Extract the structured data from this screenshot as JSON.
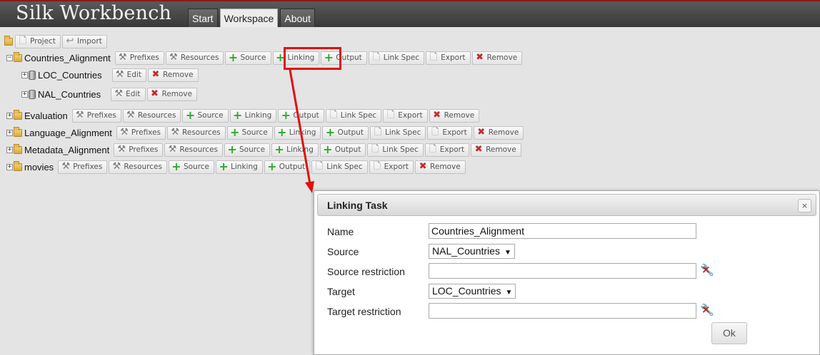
{
  "app": {
    "title": "Silk Workbench"
  },
  "nav": {
    "tabs": [
      {
        "label": "Start"
      },
      {
        "label": "Workspace"
      },
      {
        "label": "About"
      }
    ],
    "active": "Workspace"
  },
  "toolbar": {
    "project_label": "Project",
    "import_label": "Import"
  },
  "projects": [
    {
      "name": "Countries_Alignment",
      "expanded": true,
      "actions": [
        "Prefixes",
        "Resources",
        "Source",
        "Linking",
        "Output",
        "Link Spec",
        "Export",
        "Remove"
      ],
      "sources": [
        {
          "name": "LOC_Countries",
          "actions": [
            "Edit",
            "Remove"
          ]
        },
        {
          "name": "NAL_Countries",
          "actions": [
            "Edit",
            "Remove"
          ]
        }
      ]
    },
    {
      "name": "Evaluation",
      "actions": [
        "Prefixes",
        "Resources",
        "Source",
        "Linking",
        "Output",
        "Link Spec",
        "Export",
        "Remove"
      ]
    },
    {
      "name": "Language_Alignment",
      "actions": [
        "Prefixes",
        "Resources",
        "Source",
        "Linking",
        "Output",
        "Link Spec",
        "Export",
        "Remove"
      ]
    },
    {
      "name": "Metadata_Alignment",
      "actions": [
        "Prefixes",
        "Resources",
        "Source",
        "Linking",
        "Output",
        "Link Spec",
        "Export",
        "Remove"
      ]
    },
    {
      "name": "movies",
      "actions": [
        "Prefixes",
        "Resources",
        "Source",
        "Linking",
        "Output",
        "Link Spec",
        "Export",
        "Remove"
      ]
    }
  ],
  "dialog": {
    "title": "Linking Task",
    "close_label": "×",
    "name_label": "Name",
    "name_value": "Countries_Alignment",
    "source_label": "Source",
    "source_value": "NAL_Countries",
    "source_restriction_label": "Source restriction",
    "source_restriction_value": "",
    "target_label": "Target",
    "target_value": "LOC_Countries",
    "target_restriction_label": "Target restriction",
    "target_restriction_value": "",
    "ok_label": "Ok"
  },
  "colors": {
    "accent_red": "#e01010",
    "plus_green": "#2ea82e",
    "remove_red": "#c62828"
  }
}
